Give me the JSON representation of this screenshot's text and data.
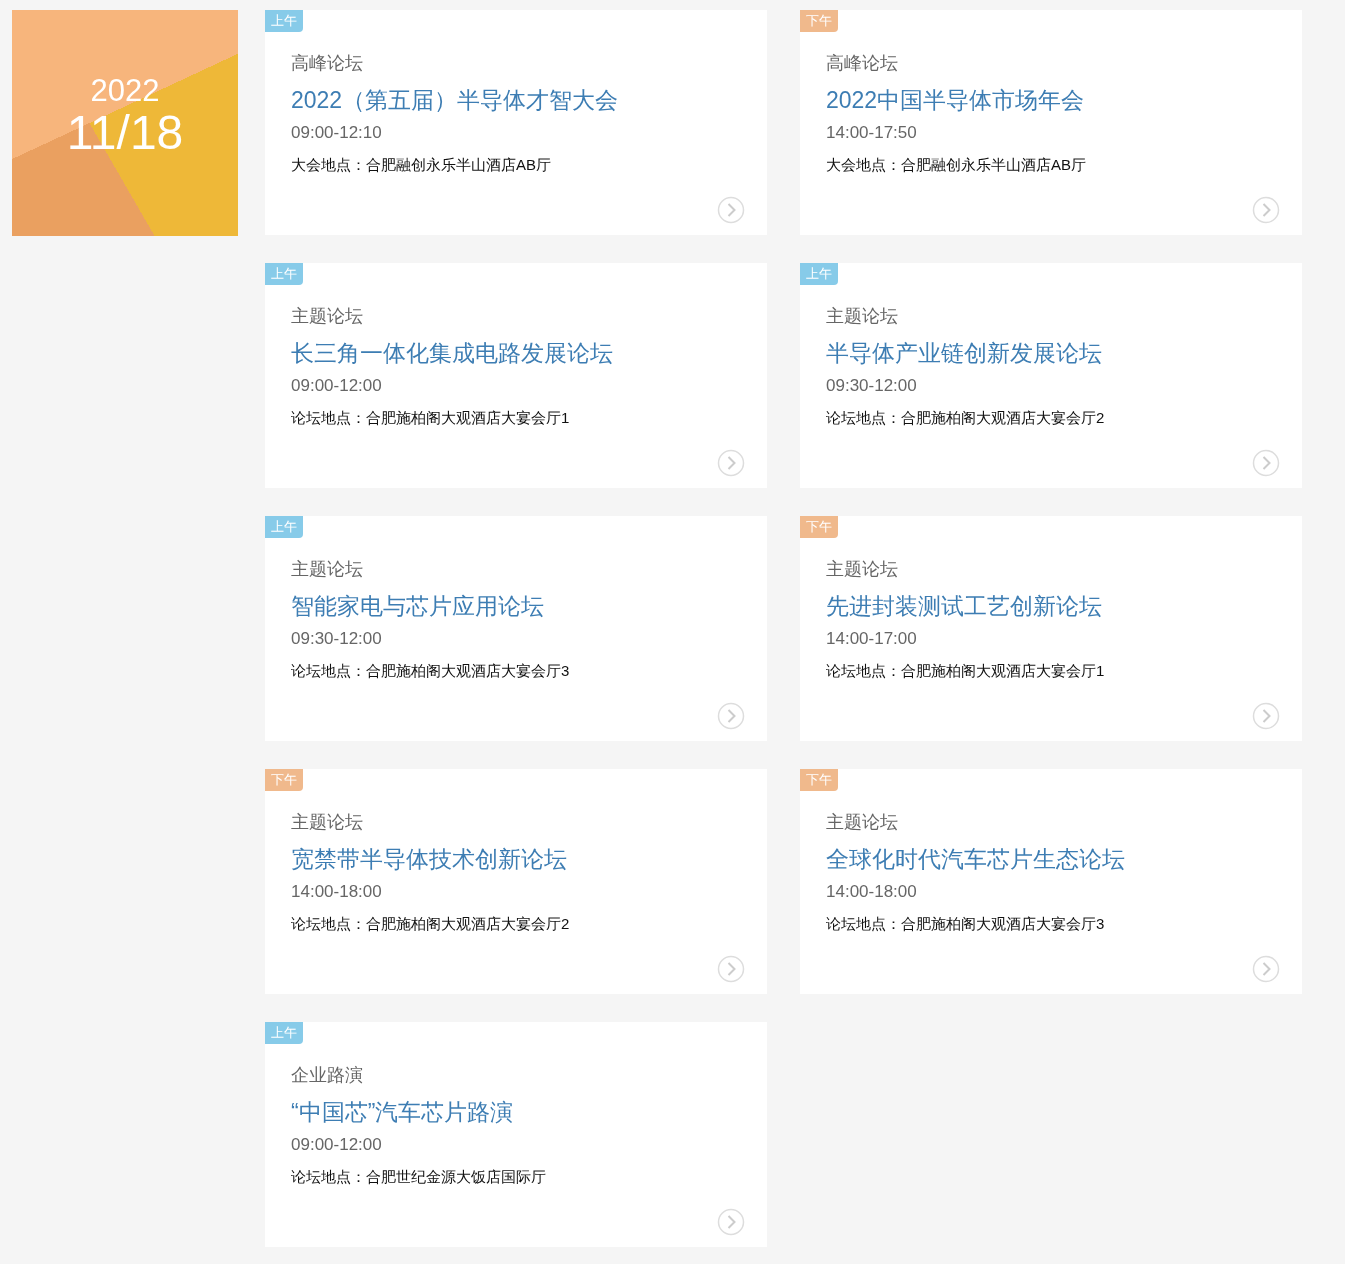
{
  "date_tile": {
    "year": "2022",
    "date": "11/18"
  },
  "sessions": [
    {
      "tag": {
        "label": "上午",
        "color": "#87cbe9"
      },
      "category": "高峰论坛",
      "title": "2022（第五届）半导体才智大会",
      "time": "09:00-12:10",
      "venue": "大会地点：合肥融创永乐半山酒店AB厅"
    },
    {
      "tag": {
        "label": "下午",
        "color": "#f0b98c"
      },
      "category": "高峰论坛",
      "title": "2022中国半导体市场年会",
      "time": "14:00-17:50",
      "venue": "大会地点：合肥融创永乐半山酒店AB厅"
    },
    {
      "tag": {
        "label": "上午",
        "color": "#87cbe9"
      },
      "category": "主题论坛",
      "title": "长三角一体化集成电路发展论坛",
      "time": "09:00-12:00",
      "venue": "论坛地点：合肥施柏阁大观酒店大宴会厅1"
    },
    {
      "tag": {
        "label": "上午",
        "color": "#87cbe9"
      },
      "category": "主题论坛",
      "title": "半导体产业链创新发展论坛",
      "time": "09:30-12:00",
      "venue": "论坛地点：合肥施柏阁大观酒店大宴会厅2"
    },
    {
      "tag": {
        "label": "上午",
        "color": "#87cbe9"
      },
      "category": "主题论坛",
      "title": "智能家电与芯片应用论坛",
      "time": "09:30-12:00",
      "venue": "论坛地点：合肥施柏阁大观酒店大宴会厅3"
    },
    {
      "tag": {
        "label": "下午",
        "color": "#f0b98c"
      },
      "category": "主题论坛",
      "title": "先进封装测试工艺创新论坛",
      "time": "14:00-17:00",
      "venue": "论坛地点：合肥施柏阁大观酒店大宴会厅1"
    },
    {
      "tag": {
        "label": "下午",
        "color": "#f0b98c"
      },
      "category": "主题论坛",
      "title": "宽禁带半导体技术创新论坛",
      "time": "14:00-18:00",
      "venue": "论坛地点：合肥施柏阁大观酒店大宴会厅2"
    },
    {
      "tag": {
        "label": "下午",
        "color": "#f0b98c"
      },
      "category": "主题论坛",
      "title": "全球化时代汽车芯片生态论坛",
      "time": "14:00-18:00",
      "venue": "论坛地点：合肥施柏阁大观酒店大宴会厅3"
    },
    {
      "tag": {
        "label": "上午",
        "color": "#87cbe9"
      },
      "category": "企业路演",
      "title": "“中国芯”汽车芯片路演",
      "time": "09:00-12:00",
      "venue": "论坛地点：合肥世纪金源大饭店国际厅"
    }
  ]
}
